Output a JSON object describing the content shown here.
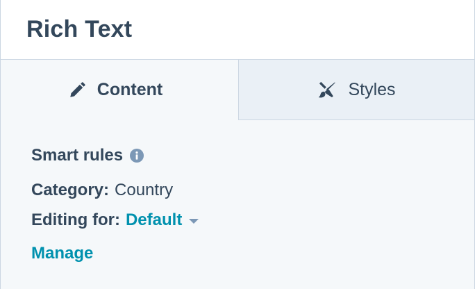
{
  "header": {
    "title": "Rich Text"
  },
  "tabs": [
    {
      "label": "Content",
      "icon": "pencil-icon",
      "active": true
    },
    {
      "label": "Styles",
      "icon": "brush-icon",
      "active": false
    }
  ],
  "smart_rules": {
    "label": "Smart rules",
    "icon": "info-icon",
    "category_label": "Category:",
    "category_value": "Country",
    "editing_label": "Editing for:",
    "editing_value": "Default",
    "manage_label": "Manage"
  },
  "colors": {
    "text": "#33475b",
    "link": "#0091ae",
    "panel_bg": "#f5f8fa",
    "inactive_tab_bg": "#eaf0f6",
    "border": "#cbd6e2"
  }
}
